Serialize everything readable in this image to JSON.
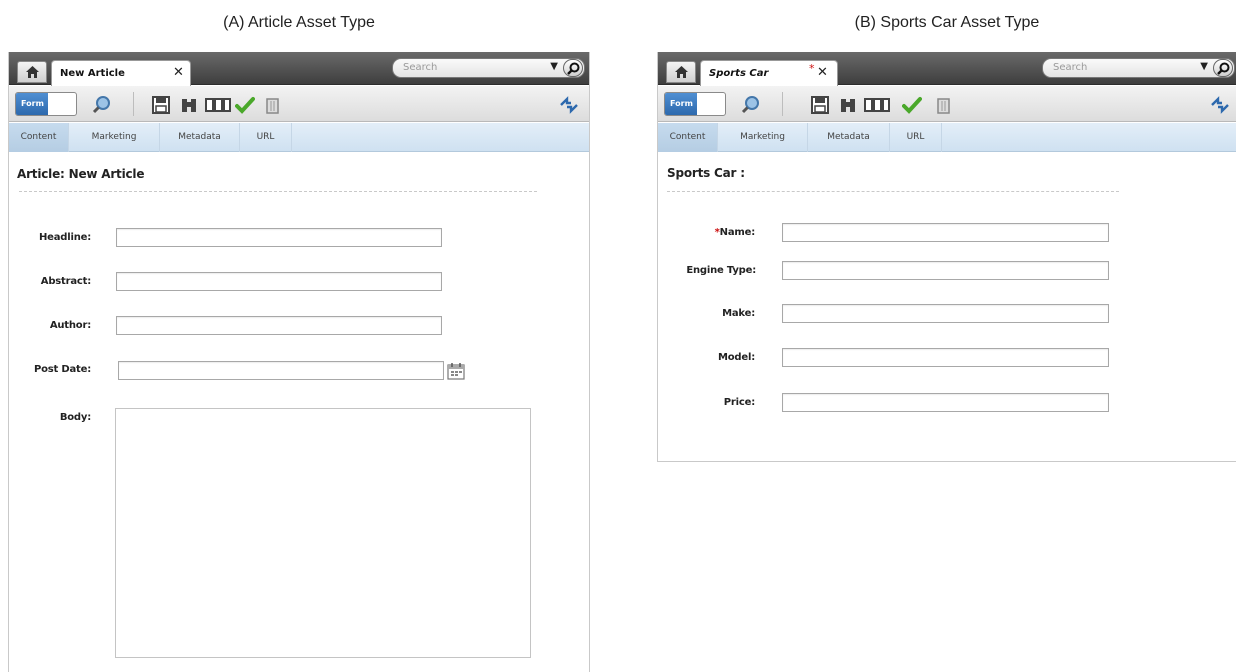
{
  "captions": {
    "a": "(A) Article Asset Type",
    "b": "(B) Sports Car Asset Type"
  },
  "panel_a": {
    "tab_title": "New Article",
    "tab_close": "✕",
    "search_placeholder": "Search",
    "form_toggle": "Form",
    "subtabs": [
      "Content",
      "Marketing",
      "Metadata",
      "URL"
    ],
    "active_subtab": "Content",
    "form_title": "Article: New Article",
    "fields": {
      "headline": {
        "label": "Headline:",
        "value": ""
      },
      "abstract": {
        "label": "Abstract:",
        "value": ""
      },
      "author": {
        "label": "Author:",
        "value": ""
      },
      "post_date": {
        "label": "Post Date:",
        "value": ""
      },
      "body": {
        "label": "Body:",
        "value": ""
      }
    }
  },
  "panel_b": {
    "tab_title": "Sports Car",
    "tab_modified_marker": "*",
    "tab_close": "✕",
    "search_placeholder": "Search",
    "form_toggle": "Form",
    "subtabs": [
      "Content",
      "Marketing",
      "Metadata",
      "URL"
    ],
    "active_subtab": "Content",
    "form_title": "Sports Car :",
    "fields": {
      "name": {
        "required_marker": "*",
        "label": "Name:",
        "value": ""
      },
      "engine_type": {
        "label": "Engine Type:",
        "value": ""
      },
      "make": {
        "label": "Make:",
        "value": ""
      },
      "model": {
        "label": "Model:",
        "value": ""
      },
      "price": {
        "label": "Price:",
        "value": ""
      }
    }
  },
  "colors": {
    "accent_blue": "#2d69ad",
    "required_red": "#cc1111",
    "check_green": "#4aa82a",
    "topbar_dark": "#4a4a4a",
    "subtab_bg": "#d6e6f4"
  },
  "icons": [
    "home-icon",
    "search-icon",
    "zoom-icon",
    "save-icon",
    "binoculars-icon",
    "columns-icon",
    "approve-check-icon",
    "delete-trash-icon",
    "sync-arrows-icon",
    "calendar-icon"
  ]
}
